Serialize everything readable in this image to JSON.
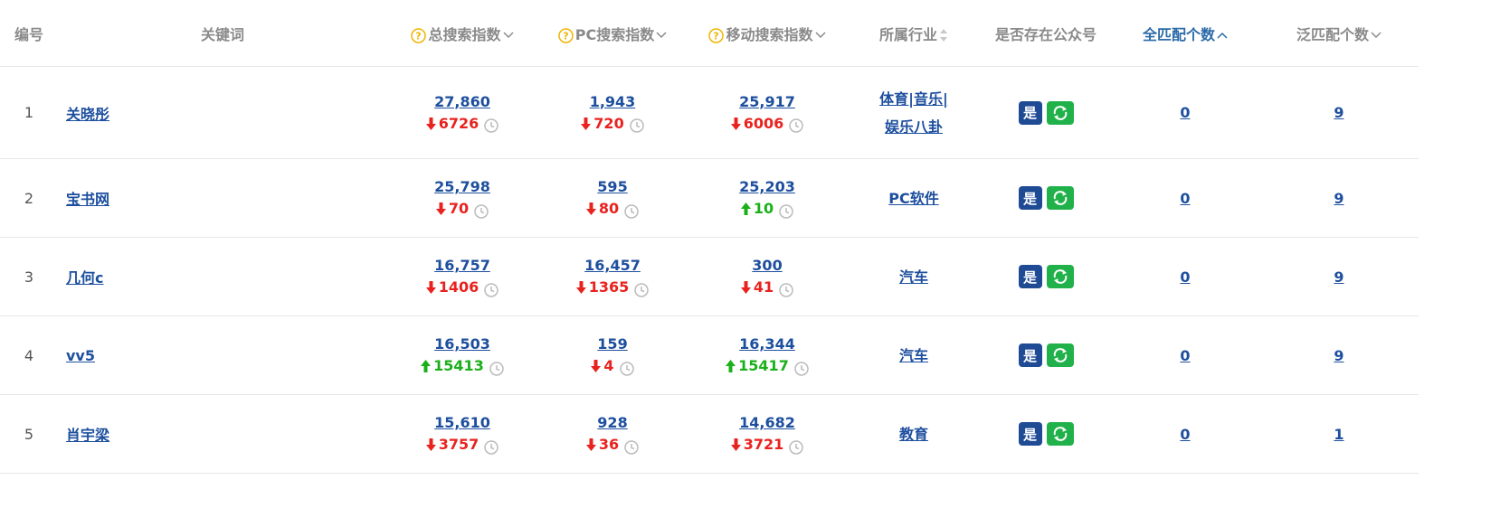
{
  "columns": {
    "id": "编号",
    "keyword": "关键词",
    "total": "总搜索指数",
    "pc": "PC搜索指数",
    "mobile": "移动搜索指数",
    "industry": "所属行业",
    "wechat": "是否存在公众号",
    "exact": "全匹配个数",
    "broad": "泛匹配个数"
  },
  "rows": [
    {
      "id": "1",
      "keyword": "关晓彤",
      "total": "27,860",
      "total_change": "6726",
      "total_dir": "down",
      "pc": "1,943",
      "pc_change": "720",
      "pc_dir": "down",
      "mobile": "25,917",
      "mobile_change": "6006",
      "mobile_dir": "down",
      "industry": [
        "体育|音乐|",
        "娱乐八卦"
      ],
      "wechat": "是",
      "exact": "0",
      "broad": "9"
    },
    {
      "id": "2",
      "keyword": "宝书网",
      "total": "25,798",
      "total_change": "70",
      "total_dir": "down",
      "pc": "595",
      "pc_change": "80",
      "pc_dir": "down",
      "mobile": "25,203",
      "mobile_change": "10",
      "mobile_dir": "up",
      "industry": [
        "PC软件"
      ],
      "wechat": "是",
      "exact": "0",
      "broad": "9"
    },
    {
      "id": "3",
      "keyword": "几何c",
      "total": "16,757",
      "total_change": "1406",
      "total_dir": "down",
      "pc": "16,457",
      "pc_change": "1365",
      "pc_dir": "down",
      "mobile": "300",
      "mobile_change": "41",
      "mobile_dir": "down",
      "industry": [
        "汽车"
      ],
      "wechat": "是",
      "exact": "0",
      "broad": "9"
    },
    {
      "id": "4",
      "keyword": "vv5",
      "total": "16,503",
      "total_change": "15413",
      "total_dir": "up",
      "pc": "159",
      "pc_change": "4",
      "pc_dir": "down",
      "mobile": "16,344",
      "mobile_change": "15417",
      "mobile_dir": "up",
      "industry": [
        "汽车"
      ],
      "wechat": "是",
      "exact": "0",
      "broad": "9"
    },
    {
      "id": "5",
      "keyword": "肖宇梁",
      "total": "15,610",
      "total_change": "3757",
      "total_dir": "down",
      "pc": "928",
      "pc_change": "36",
      "pc_dir": "down",
      "mobile": "14,682",
      "mobile_change": "3721",
      "mobile_dir": "down",
      "industry": [
        "教育"
      ],
      "wechat": "是",
      "exact": "0",
      "broad": "1"
    }
  ],
  "colors": {
    "link": "#1d4f9e",
    "down": "#e8231f",
    "up": "#1ab01a",
    "help": "#f0b400",
    "sorted_header": "#2b6aa8",
    "badge_yes": "#1f4a94",
    "badge_refresh": "#21b14a"
  },
  "icons": {
    "help": "question-circle-icon",
    "change_down": "arrow-down-icon",
    "change_up": "arrow-up-icon",
    "history": "clock-icon",
    "refresh": "refresh-icon",
    "sort": "chevron-down-icon",
    "sort_asc": "chevron-up-icon"
  }
}
